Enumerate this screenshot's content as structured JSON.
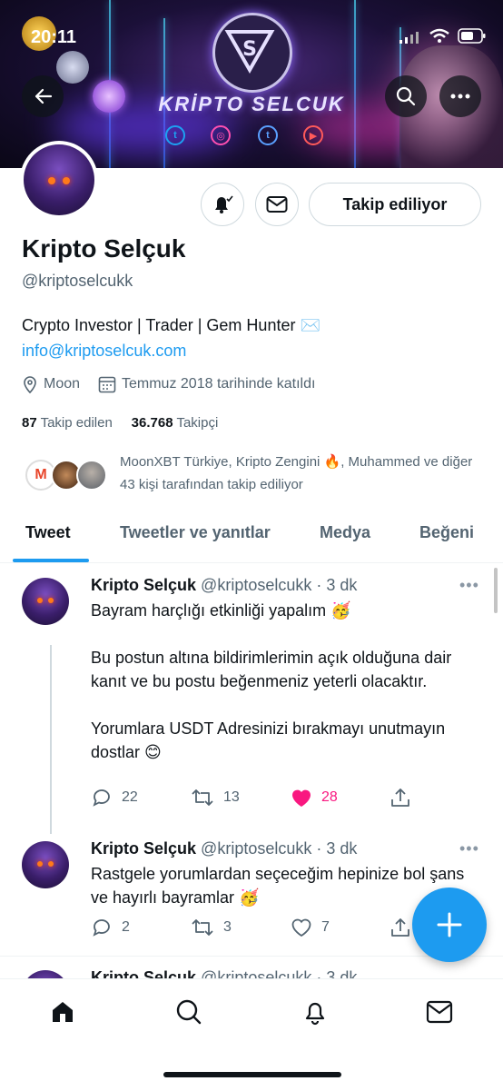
{
  "status": {
    "time": "20:11"
  },
  "banner": {
    "brand": "KRİPTO SELCUK",
    "social": [
      "twitter-icon",
      "instagram-icon",
      "tumblr-icon",
      "youtube-icon"
    ]
  },
  "profile": {
    "name": "Kripto Selçuk",
    "handle": "@kriptoselcukk",
    "bio": "Crypto Investor | Trader | Gem Hunter ✉️",
    "link": "info@kriptoselcuk.com",
    "location": "Moon",
    "joined": "Temmuz 2018 tarihinde katıldı",
    "following_count": "87",
    "following_label": "Takip edilen",
    "followers_count": "36.768",
    "followers_label": "Takipçi",
    "followed_by": "MoonXBT Türkiye, Kripto Zengini 🔥, Muhammed ve diğer 43 kişi tarafından takip ediliyor",
    "follow_button": "Takip ediliyor"
  },
  "tabs": [
    "Tweet",
    "Tweetler ve yanıtlar",
    "Medya",
    "Beğeni"
  ],
  "tweets": [
    {
      "name": "Kripto Selçuk",
      "handle": "@kriptoselcukk · 3 dk",
      "text": "Bayram harçlığı etkinliği yapalım 🥳\n\nBu postun altına bildirimlerimin açık olduğuna dair kanıt ve bu postu beğenmeniz yeterli olacaktır.\n\nYorumlara USDT Adresinizi bırakmayı unutmayın dostlar 😊",
      "replies": "22",
      "retweets": "13",
      "likes": "28"
    },
    {
      "name": "Kripto Selçuk",
      "handle": "@kriptoselcukk · 3 dk",
      "text": "Rastgele yorumlardan seçeceğim hepinize bol şans ve hayırlı bayramlar 🥳",
      "replies": "2",
      "retweets": "3",
      "likes": "7"
    },
    {
      "name": "Kripto Selçuk",
      "handle": "@kriptoselcukk · 3 dk"
    }
  ],
  "colors": {
    "accent": "#1d9bf0",
    "like": "#f91880",
    "text": "#0f1419",
    "secondary": "#536471"
  }
}
